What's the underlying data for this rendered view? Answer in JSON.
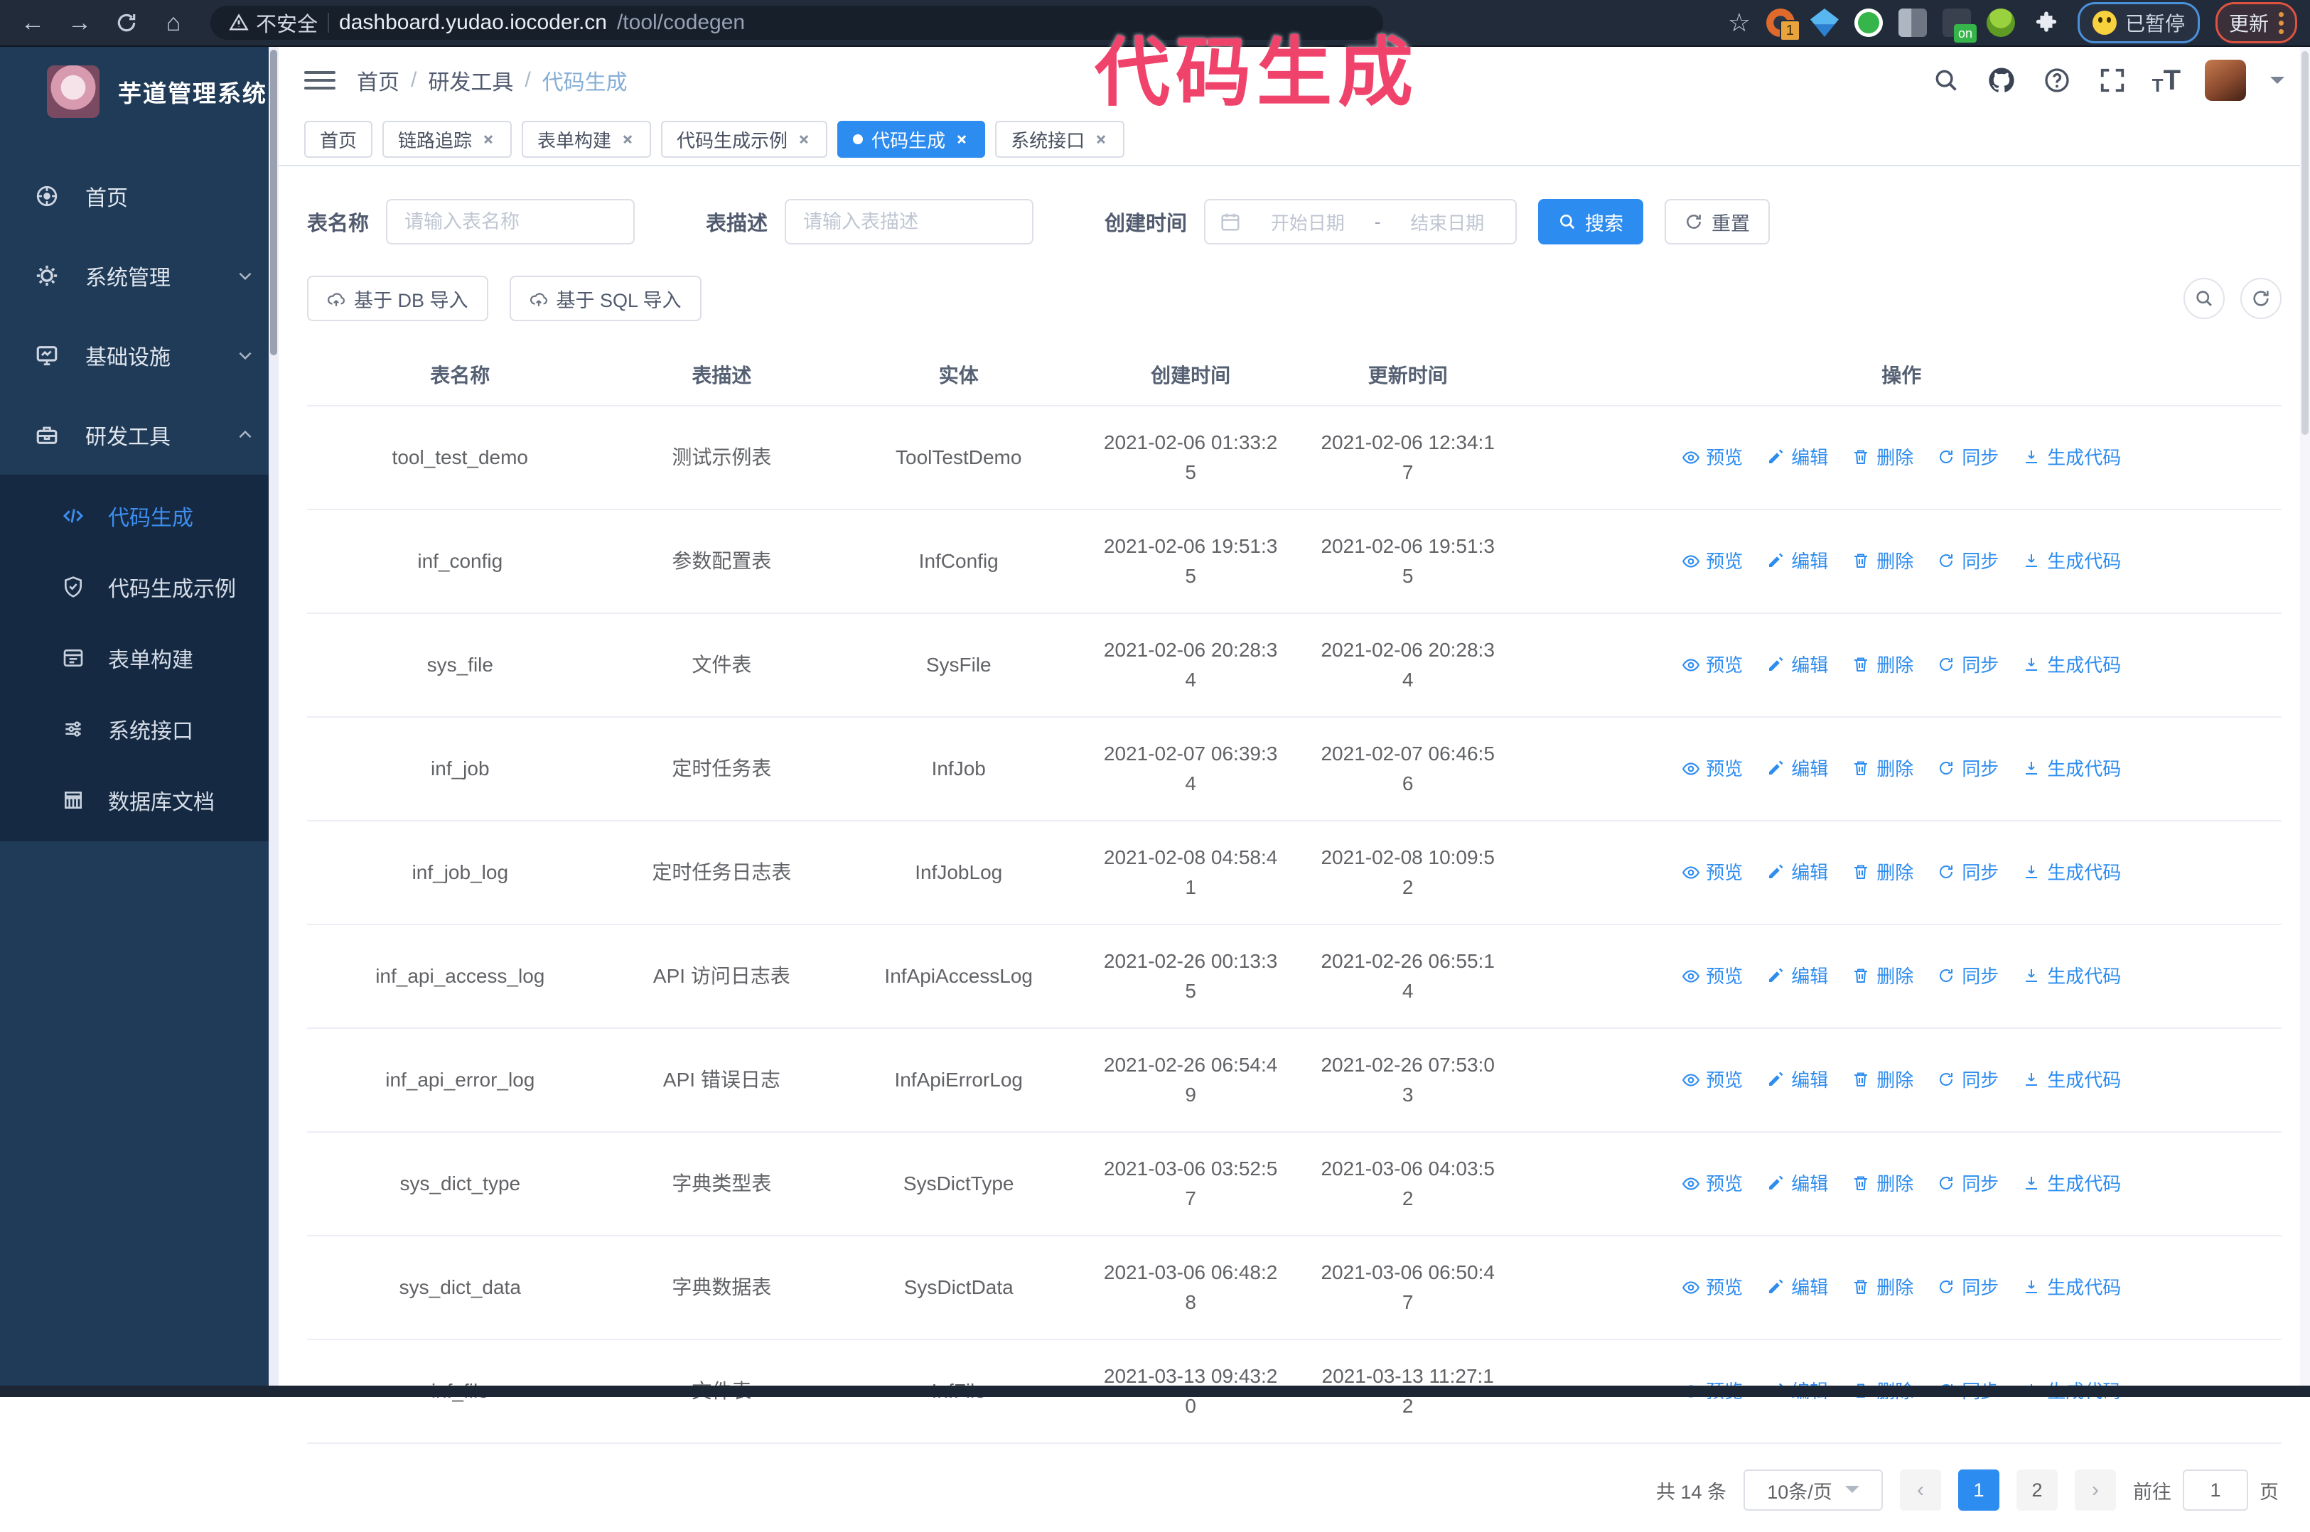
{
  "colors": {
    "primary": "#2d8cf0",
    "sidebar-bg": "#1f3b58",
    "submenu-bg": "#152a42",
    "toolbar-bg": "#212b3a",
    "watermark": "#f0436b"
  },
  "overlay": {
    "watermark": "代码生成"
  },
  "browser": {
    "security_warning": "不安全",
    "url_host": "dashboard.yudao.iocoder.cn",
    "url_path": "/tool/codegen",
    "extension_badge": "1",
    "extension_on_badge": "on",
    "paused_badge": "已暂停",
    "update_button": "更新"
  },
  "sidebar": {
    "title": "芋道管理系统",
    "menu": [
      {
        "label": "首页"
      },
      {
        "label": "系统管理"
      },
      {
        "label": "基础设施"
      },
      {
        "label": "研发工具"
      }
    ],
    "submenu": [
      {
        "label": "代码生成"
      },
      {
        "label": "代码生成示例"
      },
      {
        "label": "表单构建"
      },
      {
        "label": "系统接口"
      },
      {
        "label": "数据库文档"
      }
    ]
  },
  "header": {
    "breadcrumb": [
      "首页",
      "研发工具",
      "代码生成"
    ],
    "separator": "/"
  },
  "tabs": [
    {
      "label": "首页"
    },
    {
      "label": "链路追踪"
    },
    {
      "label": "表单构建"
    },
    {
      "label": "代码生成示例"
    },
    {
      "label": "代码生成"
    },
    {
      "label": "系统接口"
    }
  ],
  "filters": {
    "table_name_label": "表名称",
    "table_name_placeholder": "请输入表名称",
    "table_desc_label": "表描述",
    "table_desc_placeholder": "请输入表描述",
    "create_time_label": "创建时间",
    "date_start_placeholder": "开始日期",
    "date_separator": "-",
    "date_end_placeholder": "结束日期",
    "search_button": "搜索",
    "reset_button": "重置"
  },
  "toolbar": {
    "import_db": "基于 DB 导入",
    "import_sql": "基于 SQL 导入"
  },
  "table": {
    "columns": [
      "表名称",
      "表描述",
      "实体",
      "创建时间",
      "更新时间",
      "操作"
    ],
    "actions": [
      "预览",
      "编辑",
      "删除",
      "同步",
      "生成代码"
    ],
    "rows": [
      {
        "name": "tool_test_demo",
        "desc": "测试示例表",
        "entity": "ToolTestDemo",
        "created": "2021-02-06 01:33:25",
        "updated": "2021-02-06 12:34:17"
      },
      {
        "name": "inf_config",
        "desc": "参数配置表",
        "entity": "InfConfig",
        "created": "2021-02-06 19:51:35",
        "updated": "2021-02-06 19:51:35"
      },
      {
        "name": "sys_file",
        "desc": "文件表",
        "entity": "SysFile",
        "created": "2021-02-06 20:28:34",
        "updated": "2021-02-06 20:28:34"
      },
      {
        "name": "inf_job",
        "desc": "定时任务表",
        "entity": "InfJob",
        "created": "2021-02-07 06:39:34",
        "updated": "2021-02-07 06:46:56"
      },
      {
        "name": "inf_job_log",
        "desc": "定时任务日志表",
        "entity": "InfJobLog",
        "created": "2021-02-08 04:58:41",
        "updated": "2021-02-08 10:09:52"
      },
      {
        "name": "inf_api_access_log",
        "desc": "API 访问日志表",
        "entity": "InfApiAccessLog",
        "created": "2021-02-26 00:13:35",
        "updated": "2021-02-26 06:55:14"
      },
      {
        "name": "inf_api_error_log",
        "desc": "API 错误日志",
        "entity": "InfApiErrorLog",
        "created": "2021-02-26 06:54:49",
        "updated": "2021-02-26 07:53:03"
      },
      {
        "name": "sys_dict_type",
        "desc": "字典类型表",
        "entity": "SysDictType",
        "created": "2021-03-06 03:52:57",
        "updated": "2021-03-06 04:03:52"
      },
      {
        "name": "sys_dict_data",
        "desc": "字典数据表",
        "entity": "SysDictData",
        "created": "2021-03-06 06:48:28",
        "updated": "2021-03-06 06:50:47"
      },
      {
        "name": "inf_file",
        "desc": "文件表",
        "entity": "InfFile",
        "created": "2021-03-13 09:43:20",
        "updated": "2021-03-13 11:27:12"
      }
    ]
  },
  "pagination": {
    "total": "共 14 条",
    "page_size": "10条/页",
    "pages": [
      "1",
      "2"
    ],
    "goto_label": "前往",
    "goto_value": "1",
    "page_suffix": "页"
  }
}
